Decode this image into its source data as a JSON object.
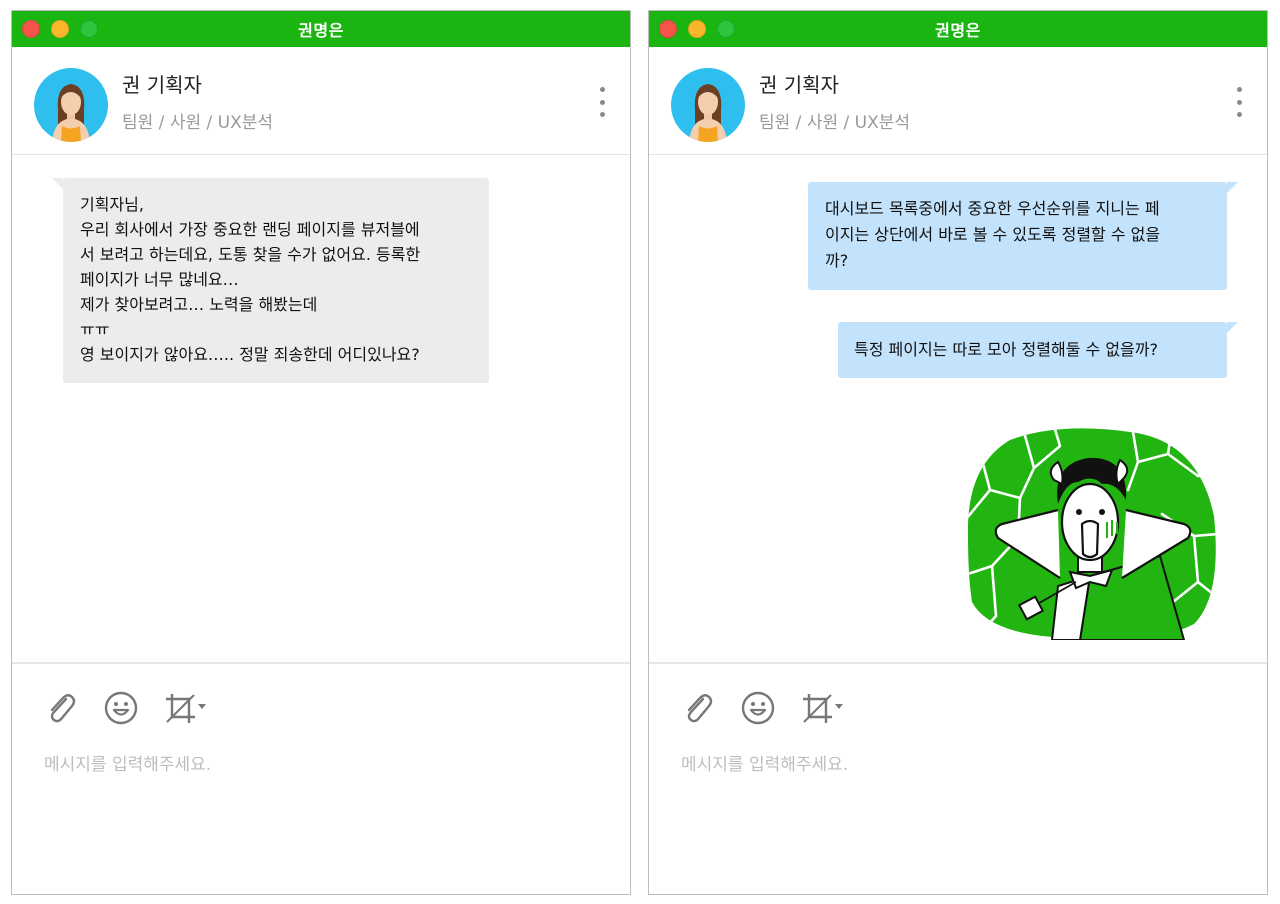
{
  "windows": [
    {
      "title": "권명은",
      "profile": {
        "name": "권 기획자",
        "subtitle": "팀원 / 사원 / UX분석"
      },
      "messages": [
        {
          "direction": "incoming",
          "text": "기획자님,\n우리 회사에서 가장 중요한 랜딩 페이지를 뷰저블에\n서 보려고 하는데요, 도통 찾을 수가 없어요. 등록한\n페이지가 너무 많네요…\n제가 찾아보려고… 노력을 해봤는데\nㅠㅠ\n영 보이지가 않아요….. 정말 죄송한데 어디있나요?"
        }
      ],
      "composer": {
        "placeholder": "메시지를 입력해주세요."
      }
    },
    {
      "title": "권명은",
      "profile": {
        "name": "권 기획자",
        "subtitle": "팀원 / 사원 / UX분석"
      },
      "messages": [
        {
          "direction": "outgoing",
          "text": "대시보드 목록중에서 중요한 우선순위를 지니는 페\n이지는 상단에서 바로 볼 수 있도록 정렬할 수 없을\n까?"
        },
        {
          "direction": "outgoing",
          "text": "특정 페이지는 따로 모아 정렬해둘 수 없을까?"
        },
        {
          "direction": "outgoing",
          "type": "sticker",
          "sticker": "shocked-man-sticker"
        }
      ],
      "composer": {
        "placeholder": "메시지를 입력해주세요."
      }
    }
  ],
  "icons": {
    "attach": "paperclip-icon",
    "emoji": "smiley-icon",
    "crop": "crop-icon",
    "menu": "kebab-menu-icon"
  },
  "colors": {
    "titlebar": "#1ab510",
    "incoming_bubble": "#ececec",
    "outgoing_bubble": "#c3e2fb",
    "avatar_bg": "#2fbfee",
    "sticker_green": "#22b411"
  }
}
